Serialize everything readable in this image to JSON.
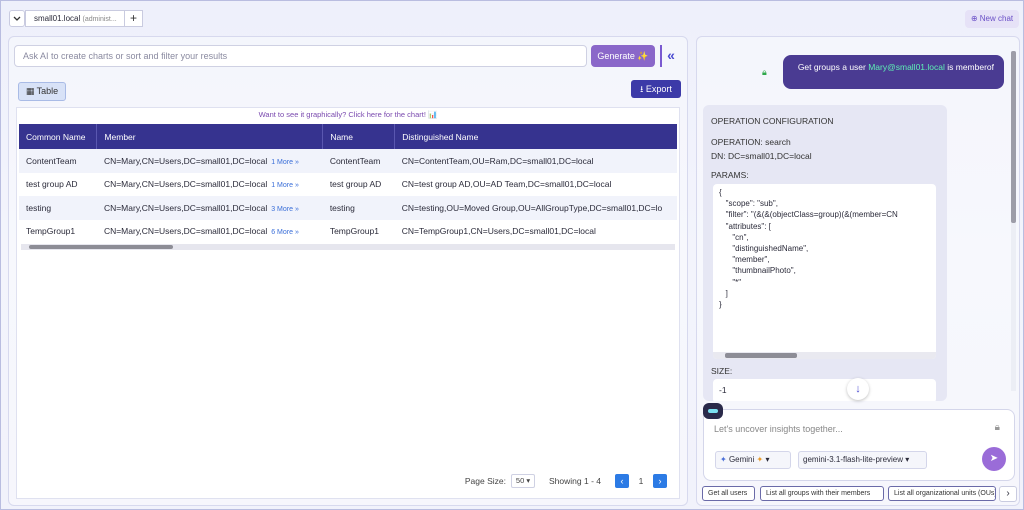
{
  "tabs": [
    {
      "label": "small01.local",
      "sub": "(administ..."
    }
  ],
  "header": {
    "new_chat": "New chat"
  },
  "left": {
    "ask_placeholder": "Ask AI to create charts or sort and filter your results",
    "generate_label": "Generate",
    "view_tab": "Table",
    "export_label": "Export",
    "chart_hint": "Want to see it graphically? Click here for the chart!",
    "table": {
      "columns": [
        "Common Name",
        "Member",
        "Name",
        "Distinguished Name"
      ],
      "rows": [
        {
          "cn": "ContentTeam",
          "member": "CN=Mary,CN=Users,DC=small01,DC=local",
          "more": "1 More",
          "name": "ContentTeam",
          "dn": "CN=ContentTeam,OU=Ram,DC=small01,DC=local"
        },
        {
          "cn": "test group AD",
          "member": "CN=Mary,CN=Users,DC=small01,DC=local",
          "more": "1 More",
          "name": "test group AD",
          "dn": "CN=test group AD,OU=AD Team,DC=small01,DC=local"
        },
        {
          "cn": "testing",
          "member": "CN=Mary,CN=Users,DC=small01,DC=local",
          "more": "3 More",
          "name": "testing",
          "dn": "CN=testing,OU=Moved Group,OU=AllGroupType,DC=small01,DC=lo"
        },
        {
          "cn": "TempGroup1",
          "member": "CN=Mary,CN=Users,DC=small01,DC=local",
          "more": "6 More",
          "name": "TempGroup1",
          "dn": "CN=TempGroup1,CN=Users,DC=small01,DC=local"
        }
      ]
    },
    "pager": {
      "page_size_label": "Page Size:",
      "page_size": "50",
      "showing": "Showing 1 - 4",
      "page": "1"
    }
  },
  "chat": {
    "user_message_pre": "Get groups a user ",
    "user_message_email": "Mary@small01.local",
    "user_message_post": " is memberof",
    "op": {
      "title": "OPERATION CONFIGURATION",
      "operation": "OPERATION: search",
      "dn": "DN: DC=small01,DC=local",
      "params_label": "PARAMS:",
      "params_text": "{\n   \"scope\": \"sub\",\n   \"filter\": \"(&(&(objectClass=group)(&(member=CN\n   \"attributes\": [\n      \"cn\",\n      \"distinguishedName\",\n      \"member\",\n      \"thumbnailPhoto\",\n      \"*\"\n   ]\n}",
      "size_label": "SIZE:",
      "size_value": "-1"
    },
    "input_placeholder": "Let's uncover insights together...",
    "model_provider": "Gemini",
    "model_name": "gemini-3.1-flash-lite-preview",
    "quick_actions": [
      "Get all users",
      "List all groups with their members",
      "List all organizational units (OUs)"
    ]
  }
}
